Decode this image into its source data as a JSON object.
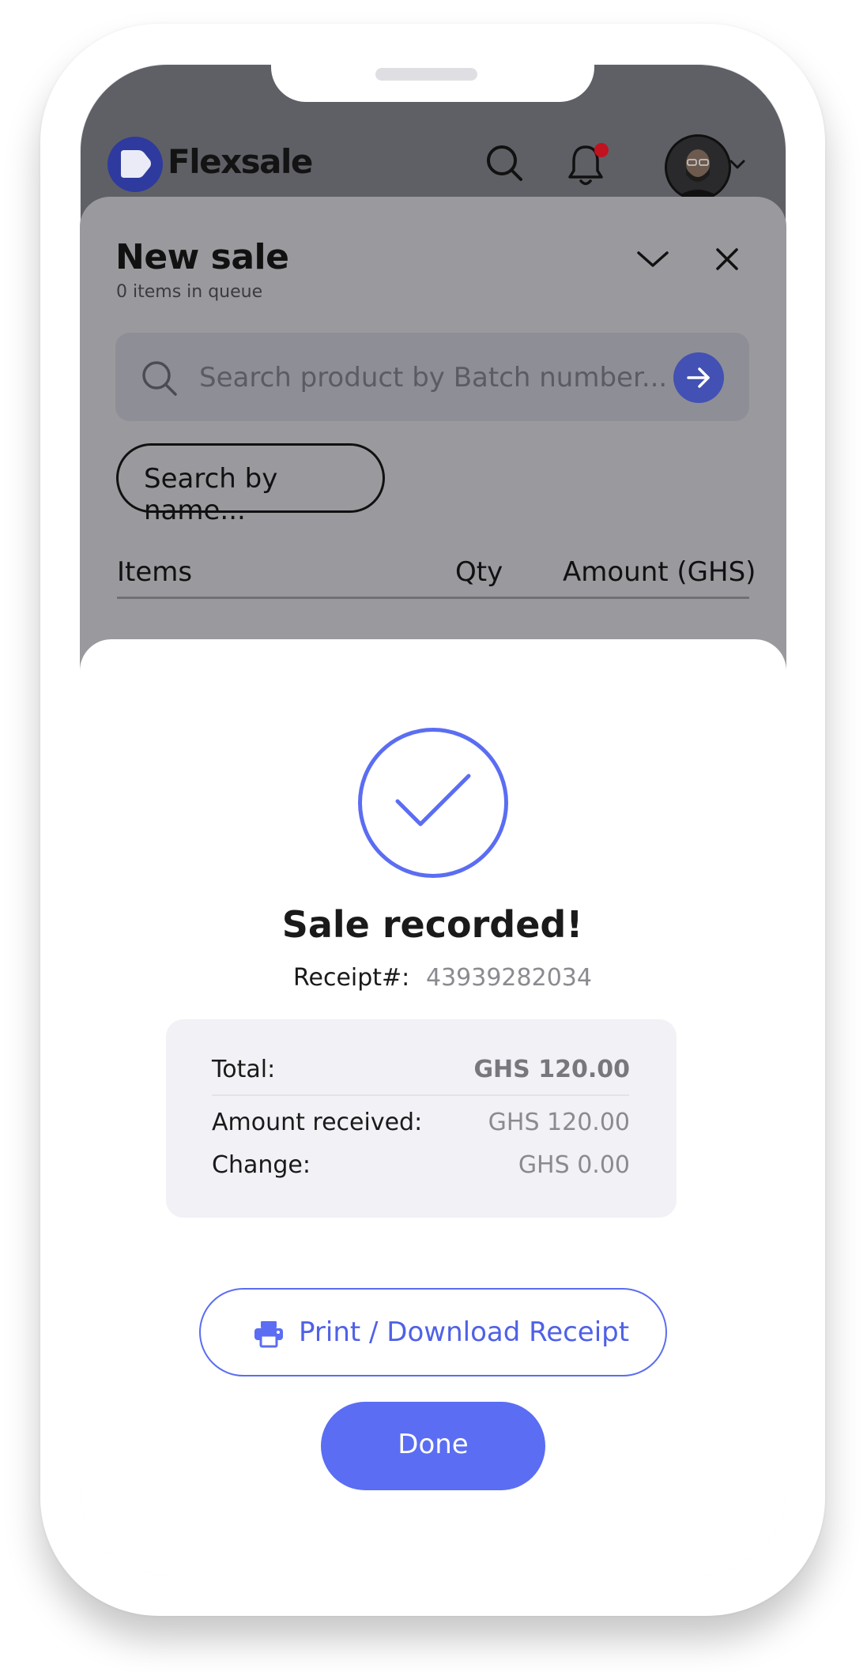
{
  "app": {
    "brand_name": "Flexsale",
    "accent_color": "#5b6df2"
  },
  "header": {
    "icons": [
      "search-icon",
      "bell-icon",
      "avatar",
      "chevron-down-icon"
    ],
    "has_unread_notification": true,
    "notification_dot_color": "#c1121f"
  },
  "sale": {
    "title": "New sale",
    "subtitle": "0 items in queue",
    "search_placeholder": "Search product by Batch number...",
    "search_by_name_label": "Search by name...",
    "columns": [
      "Items",
      "Qty",
      "Amount (GHS)"
    ]
  },
  "modal": {
    "title": "Sale recorded!",
    "receipt_label": "Receipt#:",
    "receipt_number": "43939282034",
    "summary": {
      "total_label": "Total:",
      "total_value": "GHS 120.00",
      "received_label": "Amount received:",
      "received_value": "GHS 120.00",
      "change_label": "Change:",
      "change_value": "GHS 0.00"
    },
    "print_label": "Print / Download Receipt",
    "done_label": "Done"
  }
}
